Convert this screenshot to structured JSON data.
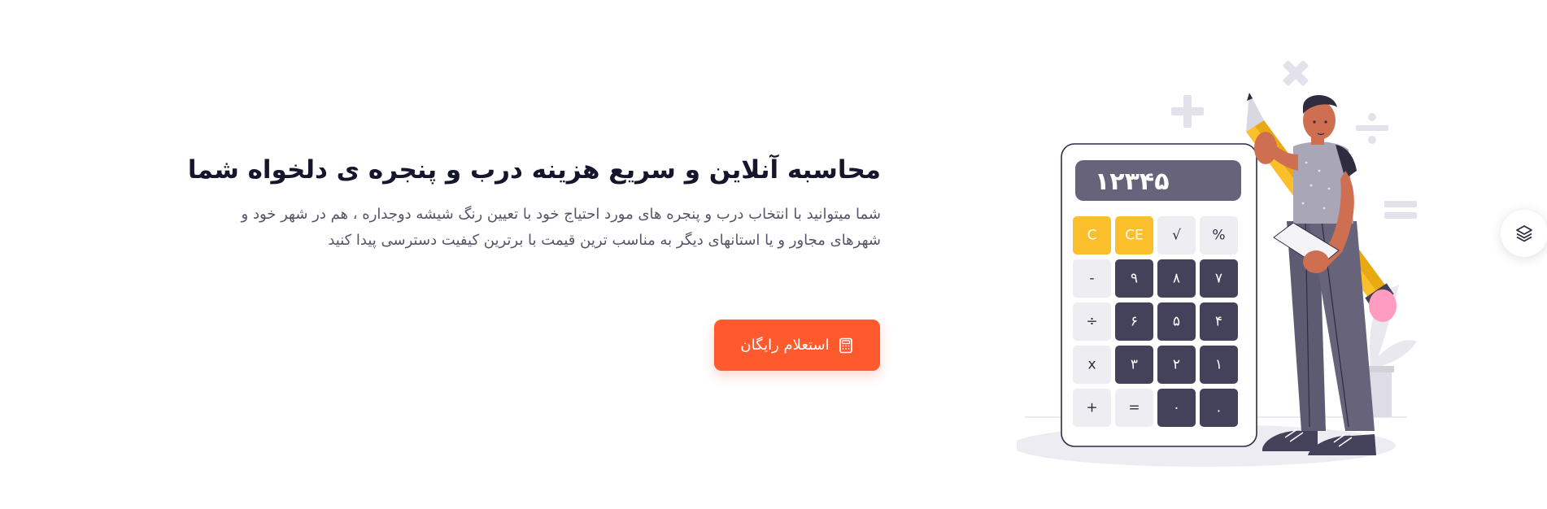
{
  "hero": {
    "title": "محاسبه آنلاین و سریع هزینه درب و پنجره ی دلخواه شما",
    "description": "شما میتوانید با انتخاب درب و پنجره های مورد احتیاج خود با تعیین رنگ شیشه دوجداره ، هم در شهر خود و شهرهای مجاور و یا استانهای دیگر به مناسب ترین قیمت با برترین کیفیت دسترسی پیدا کنید",
    "cta_label": "استعلام رایگان",
    "cta_icon": "calculator-icon"
  },
  "illustration": {
    "display_value": "۱۲۳۴۵",
    "keys": [
      [
        "%",
        "√",
        "CE",
        "C"
      ],
      [
        "۷",
        "۸",
        "۹",
        "-"
      ],
      [
        "۴",
        "۵",
        "۶",
        "÷"
      ],
      [
        "۱",
        "۲",
        "۳",
        "x"
      ],
      [
        ".",
        "۰",
        "=",
        "+"
      ]
    ],
    "decor_symbols": [
      "+",
      "×",
      "÷",
      "="
    ]
  },
  "fab": {
    "icon": "layers-icon"
  },
  "colors": {
    "accent": "#ff5a2e",
    "title": "#15152b",
    "text": "#55556a",
    "calc_dark": "#44415a",
    "calc_yellow": "#fbbf2c",
    "calc_light": "#eeedf2",
    "calc_display": "#66637a"
  }
}
